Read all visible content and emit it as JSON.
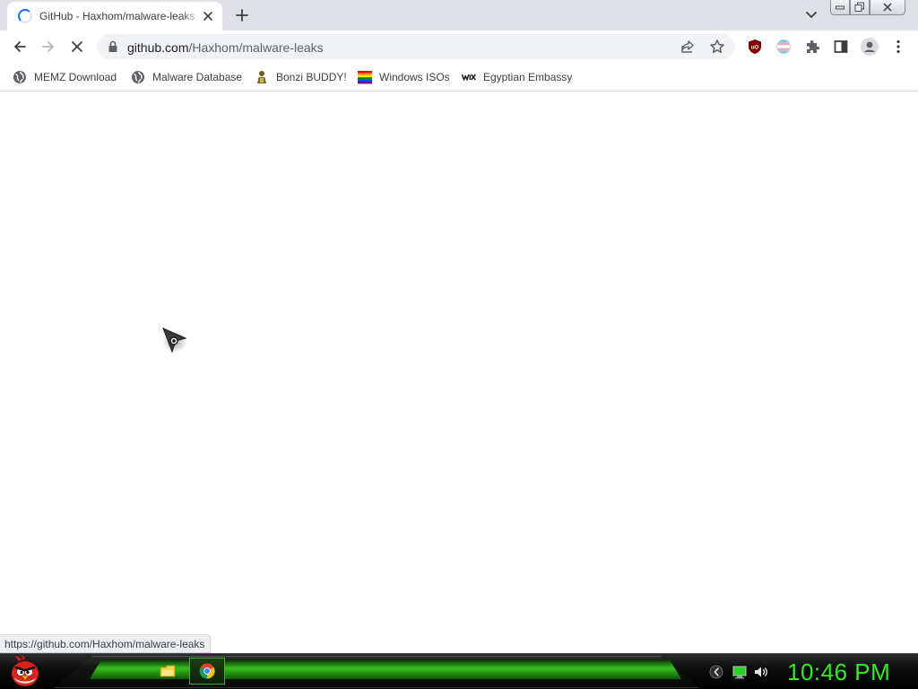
{
  "colors": {
    "tabstrip_bg": "#dee1e6",
    "accent": "#1a73e8",
    "clock": "#35e82a",
    "taskbar_glow": "#36c81e"
  },
  "tab": {
    "title": "GitHub - Haxhom/malware-leaks",
    "state": "loading",
    "icon": "loading-spinner-icon"
  },
  "tabstrip": {
    "new_tab_icon": "plus-icon",
    "tab_search_icon": "chevron-down-icon",
    "window_buttons": [
      "minimize-icon",
      "restore-icon",
      "close-icon"
    ]
  },
  "toolbar": {
    "icons": [
      "back-arrow-icon",
      "forward-arrow-icon",
      "stop-loading-icon"
    ],
    "omnibox": {
      "host": "github.com",
      "path": "/Haxhom/malware-leaks",
      "icons": [
        "lock-icon",
        "share-icon",
        "star-icon"
      ]
    },
    "extensions": [
      "ublock-origin-icon",
      "trans-flag-extension-icon",
      "puzzle-extensions-icon",
      "side-panel-icon",
      "profile-avatar-icon",
      "more-vert-icon"
    ]
  },
  "bookmarks": [
    {
      "label": "MEMZ Download",
      "icon": "globe-icon"
    },
    {
      "label": "Malware Database",
      "icon": "globe-icon"
    },
    {
      "label": "Bonzi BUDDY!",
      "icon": "bonzi-icon"
    },
    {
      "label": "Windows ISOs",
      "icon": "rainbow-flag-icon"
    },
    {
      "label": "Egyptian Embassy",
      "icon": "wix-icon"
    }
  ],
  "status_bar": {
    "url": "https://github.com/Haxhom/malware-leaks"
  },
  "taskbar": {
    "start_icon": "angry-bird-start-icon",
    "apps": [
      {
        "name": "file-explorer-icon",
        "active": false
      },
      {
        "name": "chrome-icon",
        "active": true
      }
    ],
    "tray_icons": [
      "tray-update-icon",
      "network-monitor-icon",
      "speaker-icon"
    ],
    "clock": "10:46 PM"
  }
}
